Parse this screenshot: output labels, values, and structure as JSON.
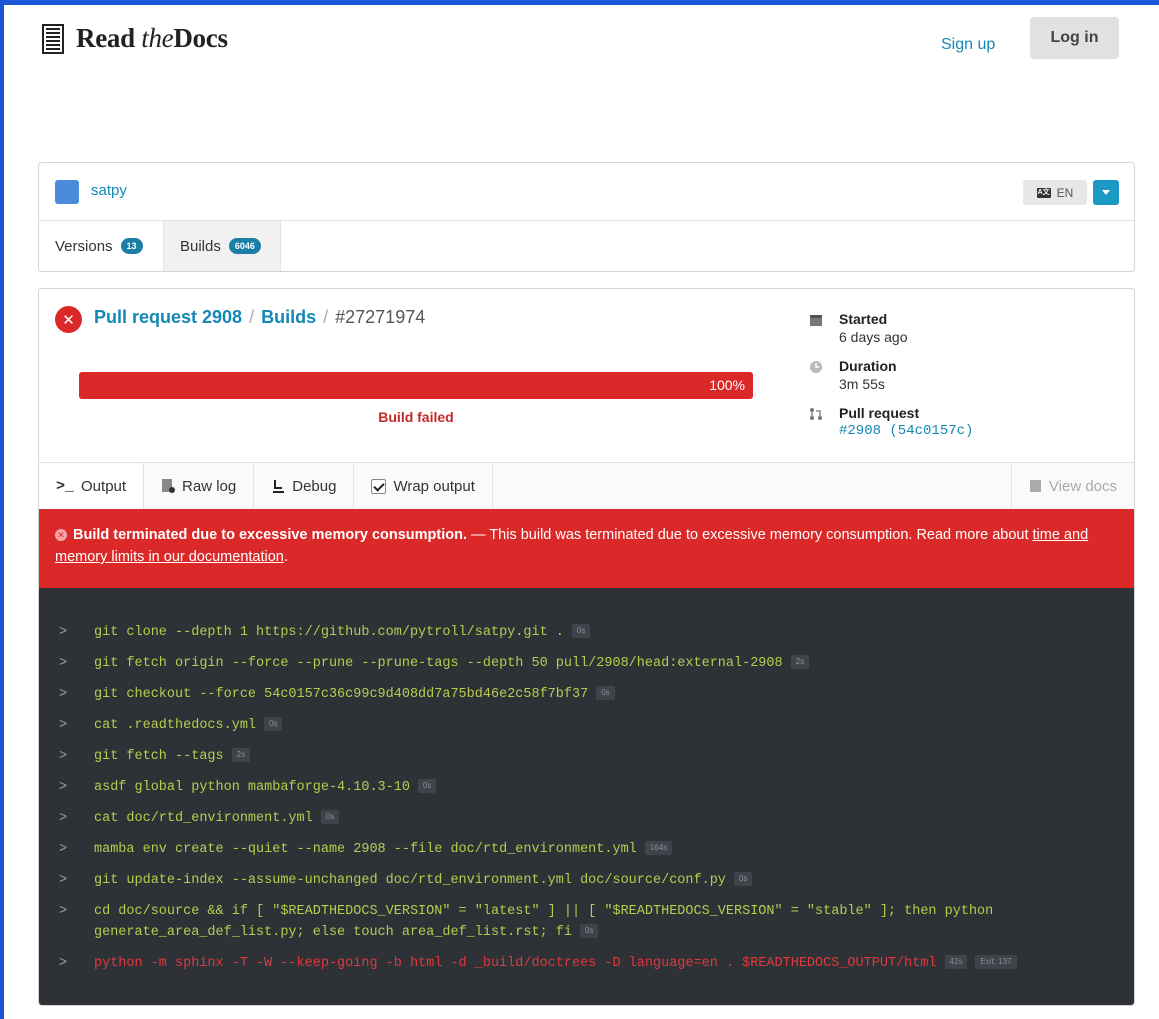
{
  "header": {
    "logo_main": "Read",
    "logo_italic": "the",
    "logo_end": "Docs",
    "signup": "Sign up",
    "login": "Log in"
  },
  "project": {
    "name": "satpy",
    "language": "EN",
    "lang_icon": "A文",
    "tabs": [
      {
        "label": "Versions",
        "count": "13"
      },
      {
        "label": "Builds",
        "count": "6046"
      }
    ]
  },
  "build": {
    "breadcrumb": {
      "pr": "Pull request 2908",
      "sep": "/",
      "builds": "Builds",
      "id": "#27271974"
    },
    "progress_percent": 100,
    "progress_label": "100%",
    "status": "Build failed",
    "meta": {
      "started_label": "Started",
      "started_value": "6 days ago",
      "duration_label": "Duration",
      "duration_value": "3m 55s",
      "pr_label": "Pull request",
      "pr_value": "#2908 (54c0157c)"
    },
    "toolbar": {
      "output": "Output",
      "raw_log": "Raw log",
      "debug": "Debug",
      "wrap_output": "Wrap output",
      "view_docs": "View docs"
    },
    "error": {
      "title": "Build terminated due to excessive memory consumption.",
      "message": " — This build was terminated due to excessive memory consumption. Read more about ",
      "link": "time and memory limits in our documentation",
      "end": "."
    },
    "commands": [
      {
        "cmd": "git clone --depth 1 https://github.com/pytroll/satpy.git .",
        "duration": "0s"
      },
      {
        "cmd": "git fetch origin --force --prune --prune-tags --depth 50 pull/2908/head:external-2908",
        "duration": "2s"
      },
      {
        "cmd": "git checkout --force 54c0157c36c99c9d408dd7a75bd46e2c58f7bf37",
        "duration": "0s"
      },
      {
        "cmd": "cat .readthedocs.yml",
        "duration": "0s"
      },
      {
        "cmd": "git fetch --tags",
        "duration": "2s"
      },
      {
        "cmd": "asdf global python mambaforge-4.10.3-10",
        "duration": "0s"
      },
      {
        "cmd": "cat doc/rtd_environment.yml",
        "duration": "0s"
      },
      {
        "cmd": "mamba env create --quiet --name 2908 --file doc/rtd_environment.yml",
        "duration": "164s"
      },
      {
        "cmd": "git update-index --assume-unchanged doc/rtd_environment.yml doc/source/conf.py",
        "duration": "0s"
      },
      {
        "cmd": "cd doc/source && if [ \"$READTHEDOCS_VERSION\" = \"latest\" ] || [ \"$READTHEDOCS_VERSION\" = \"stable\" ]; then python generate_area_def_list.py; else touch area_def_list.rst; fi",
        "duration": "0s"
      },
      {
        "cmd": "python -m sphinx -T -W --keep-going -b html -d _build/doctrees -D language=en . $READTHEDOCS_OUTPUT/html",
        "duration": "42s",
        "exit": "Exit: 137",
        "failed": true
      }
    ],
    "caret": ">"
  },
  "colors": {
    "brand": "#1488b4",
    "error": "#db2828",
    "terminal_bg": "#2e3136",
    "cmd_text": "#b7cc4f"
  }
}
